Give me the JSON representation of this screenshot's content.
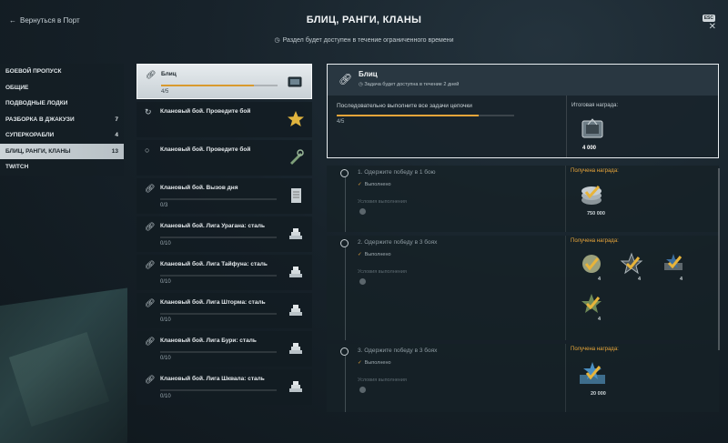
{
  "header": {
    "back_label": "Вернуться в Порт",
    "title": "БЛИЦ, РАНГИ, КЛАНЫ",
    "esc_label": "ESC",
    "notice": "Раздел будет доступен в течение ограниченного времени"
  },
  "sidebar": {
    "items": [
      {
        "label": "БОЕВОЙ ПРОПУСК",
        "count": ""
      },
      {
        "label": "ОБЩИЕ",
        "count": ""
      },
      {
        "label": "ПОДВОДНЫЕ ЛОДКИ",
        "count": ""
      },
      {
        "label": "РАЗБОРКА В ДЖАКУЗИ",
        "count": "7"
      },
      {
        "label": "СУПЕРКОРАБЛИ",
        "count": "4"
      },
      {
        "label": "БЛИЦ, РАНГИ, КЛАНЫ",
        "count": "13"
      },
      {
        "label": "TWITCH",
        "count": ""
      }
    ]
  },
  "tasks": [
    {
      "name": "Блиц",
      "progress": "4/5",
      "fill": 0.8,
      "icon": "link-icon",
      "reward": "container"
    },
    {
      "name": "Клановый бой. Проведите бой",
      "progress": "",
      "fill": 0,
      "icon": "refresh-icon",
      "reward": "star"
    },
    {
      "name": "Клановый бой. Проведите бой",
      "progress": "",
      "fill": 0,
      "icon": "dot-icon",
      "reward": "wrench"
    },
    {
      "name": "Клановый бой. Вызов дня",
      "progress": "0/3",
      "fill": 0,
      "icon": "link-icon",
      "reward": "document"
    },
    {
      "name": "Клановый бой. Лига Урагана: сталь",
      "progress": "0/10",
      "fill": 0,
      "icon": "link-icon",
      "reward": "steel"
    },
    {
      "name": "Клановый бой. Лига Тайфуна: сталь",
      "progress": "0/10",
      "fill": 0,
      "icon": "link-icon",
      "reward": "steel"
    },
    {
      "name": "Клановый бой. Лига Шторма: сталь",
      "progress": "0/10",
      "fill": 0,
      "icon": "link-icon",
      "reward": "steel"
    },
    {
      "name": "Клановый бой. Лига Бури: сталь",
      "progress": "0/10",
      "fill": 0,
      "icon": "link-icon",
      "reward": "steel"
    },
    {
      "name": "Клановый бой. Лига Шквала: сталь",
      "progress": "0/10",
      "fill": 0,
      "icon": "link-icon",
      "reward": "steel"
    }
  ],
  "detail": {
    "title": "Блиц",
    "subtitle": "Задача будет доступна в течение 2 дней",
    "description": "Последовательно выполните все задачи цепочки",
    "progress": "4/5",
    "fill": 0.8,
    "final_reward_label": "Итоговая награда:",
    "final_reward_value": "4 000",
    "steps": [
      {
        "title": "1. Одержите победу в 1 бою",
        "status": "Выполнено",
        "condition": "Условия выполнения",
        "reward_label": "Получена награда:",
        "rewards": [
          "750 000"
        ]
      },
      {
        "title": "2. Одержите победу в 3 боях",
        "status": "Выполнено",
        "condition": "Условия выполнения",
        "reward_label": "Получена награда:",
        "rewards": [
          "4",
          "4",
          "4",
          "4"
        ]
      },
      {
        "title": "3. Одержите победу в 3 боях",
        "status": "Выполнено",
        "condition": "Условия выполнения",
        "reward_label": "Получена награда:",
        "rewards": [
          "20 000"
        ]
      }
    ]
  },
  "colors": {
    "accent": "#e8a53a",
    "active_bg": "#cdd4d8"
  }
}
